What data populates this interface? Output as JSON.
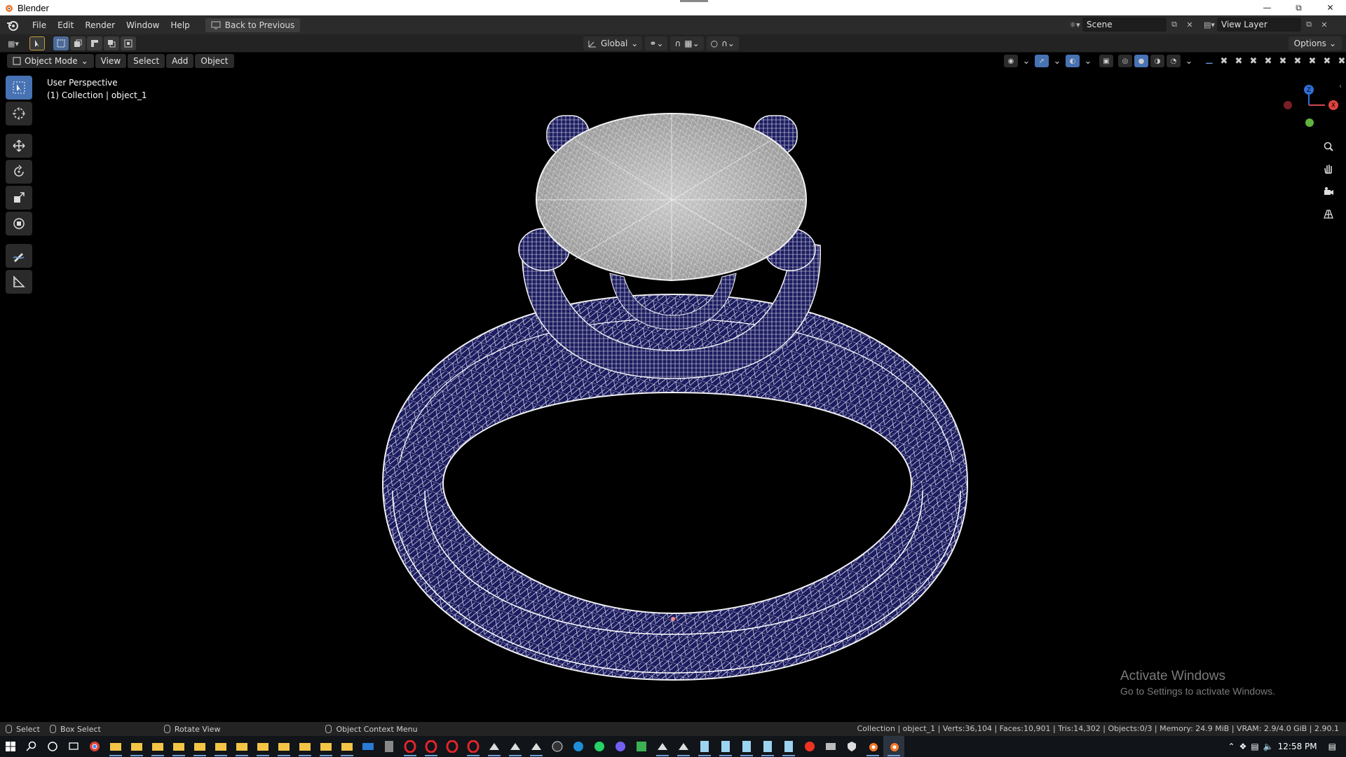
{
  "window": {
    "title": "Blender"
  },
  "menubar": {
    "items": [
      "File",
      "Edit",
      "Render",
      "Window",
      "Help"
    ],
    "back_label": "Back to Previous",
    "scene": "Scene",
    "view_layer": "View Layer"
  },
  "toolheader": {
    "orientation": "Global",
    "options_label": "Options"
  },
  "viewport_header": {
    "mode": "Object Mode",
    "menus": [
      "View",
      "Select",
      "Add",
      "Object"
    ]
  },
  "viewport": {
    "perspective": "User Perspective",
    "collection": "(1) Collection | object_1",
    "gizmo": {
      "z": "Z",
      "x": "X",
      "y": "Y"
    }
  },
  "watermark": {
    "line1": "Activate Windows",
    "line2": "Go to Settings to activate Windows."
  },
  "statusbar": {
    "select": "Select",
    "box_select": "Box Select",
    "rotate_view": "Rotate View",
    "context_menu": "Object Context Menu",
    "stats": "Collection | object_1 | Verts:36,104 | Faces:10,901 | Tris:14,302 | Objects:0/3 | Memory: 24.9 MiB | VRAM: 2.9/4.0 GiB | 2.90.1"
  },
  "taskbar": {
    "time": "12:58 PM"
  },
  "colors": {
    "accent": "#4772b3",
    "band": "#1a1a5c",
    "wire": "#e8e8f0"
  }
}
